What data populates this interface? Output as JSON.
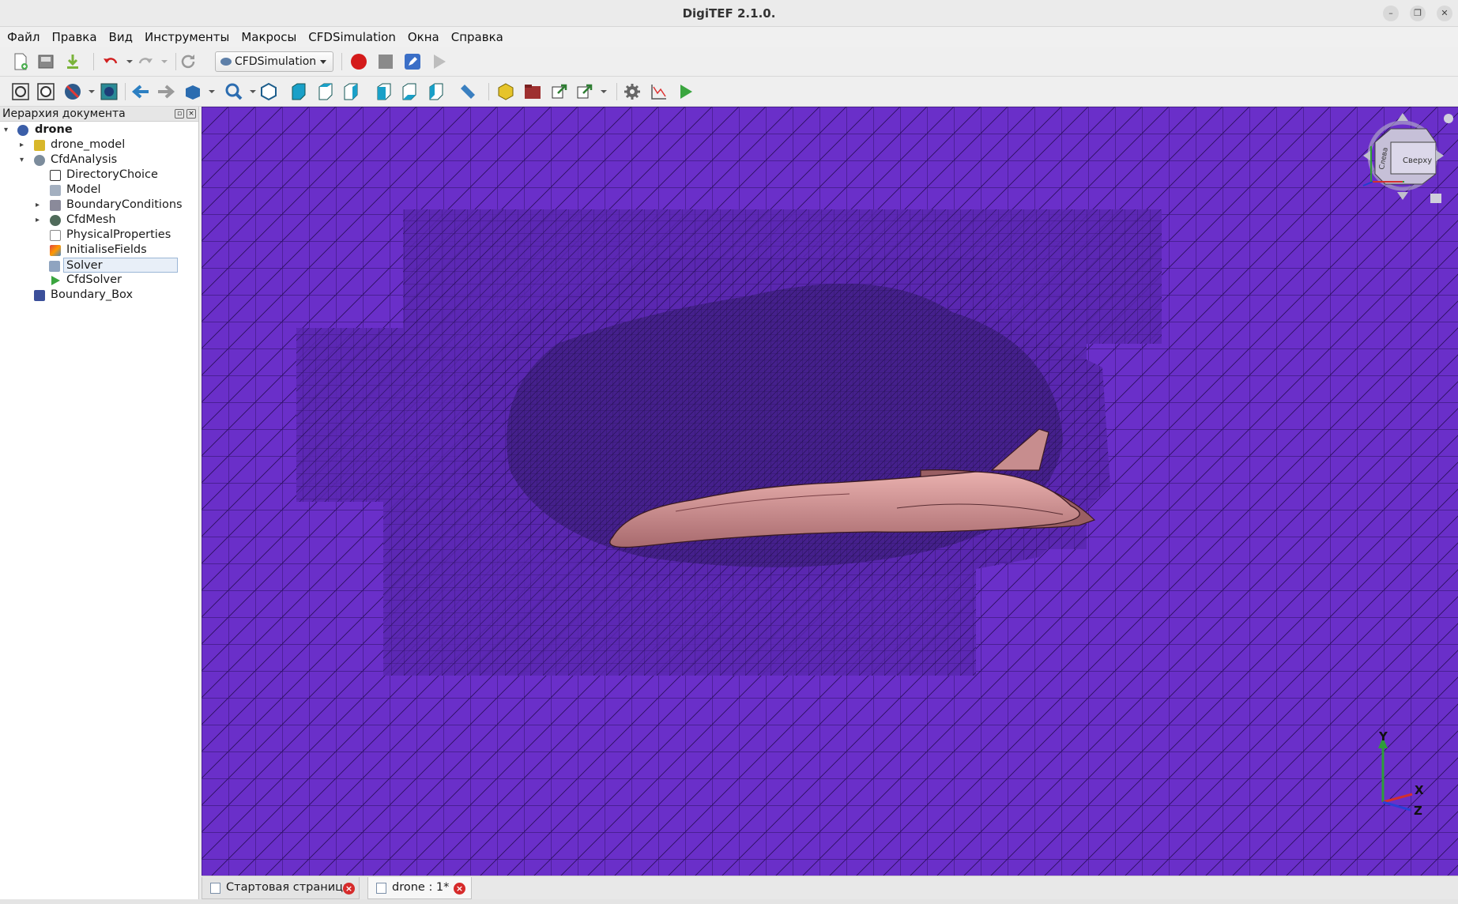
{
  "window": {
    "title": "DigiTEF 2.1.0."
  },
  "menu": [
    "Файл",
    "Правка",
    "Вид",
    "Инструменты",
    "Макросы",
    "CFDSimulation",
    "Окна",
    "Справка"
  ],
  "toolbar": {
    "workbench": "CFDSimulation"
  },
  "panel": {
    "title": "Иерархия документа"
  },
  "tree": {
    "root": "drone",
    "drone_model": "drone_model",
    "cfd_analysis": "CfdAnalysis",
    "directory_choice": "DirectoryChoice",
    "model": "Model",
    "boundary_conditions": "BoundaryConditions",
    "cfd_mesh": "CfdMesh",
    "physical_properties": "PhysicalProperties",
    "initialise_fields": "InitialiseFields",
    "solver": "Solver",
    "cfd_solver": "CfdSolver",
    "boundary_box": "Boundary_Box"
  },
  "navcube": {
    "face_front": "Сверху",
    "face_left": "Слева"
  },
  "axes": {
    "y": "Y",
    "x": "X",
    "z": "Z"
  },
  "tabs": [
    {
      "label": "Стартовая страница"
    },
    {
      "label": "drone : 1*"
    }
  ],
  "colors": {
    "background": "#6a2fc9",
    "mesh_line": "#2b1060",
    "model": "#d9999b"
  }
}
